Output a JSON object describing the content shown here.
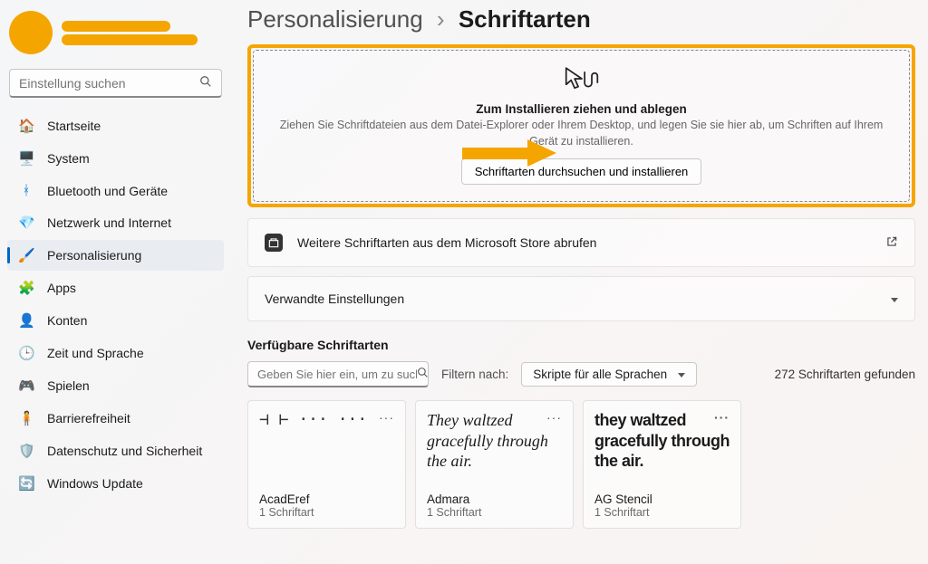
{
  "search": {
    "placeholder": "Einstellung suchen"
  },
  "sidebar": {
    "items": [
      {
        "icon": "🏠",
        "label": "Startseite"
      },
      {
        "icon": "🖥️",
        "label": "System"
      },
      {
        "icon": "ᚼ",
        "label": "Bluetooth und Geräte",
        "iconColor": "#0078d4"
      },
      {
        "icon": "💎",
        "label": "Netzwerk und Internet"
      },
      {
        "icon": "🖌️",
        "label": "Personalisierung"
      },
      {
        "icon": "🧩",
        "label": "Apps"
      },
      {
        "icon": "👤",
        "label": "Konten"
      },
      {
        "icon": "🕒",
        "label": "Zeit und Sprache"
      },
      {
        "icon": "🎮",
        "label": "Spielen"
      },
      {
        "icon": "🧍",
        "label": "Barrierefreiheit",
        "iconColor": "#0078d4"
      },
      {
        "icon": "🛡️",
        "label": "Datenschutz und Sicherheit"
      },
      {
        "icon": "🔄",
        "label": "Windows Update",
        "iconColor": "#0078d4"
      }
    ],
    "selectedIndex": 4
  },
  "breadcrumb": {
    "parent": "Personalisierung",
    "current": "Schriftarten"
  },
  "dragdrop": {
    "title": "Zum Installieren ziehen und ablegen",
    "desc": "Ziehen Sie Schriftdateien aus dem Datei-Explorer oder Ihrem Desktop, und legen Sie sie hier ab, um Schriften auf Ihrem Gerät zu installieren.",
    "button": "Schriftarten durchsuchen und installieren"
  },
  "storeRow": {
    "label": "Weitere Schriftarten aus dem Microsoft Store abrufen"
  },
  "relatedRow": {
    "label": "Verwandte Einstellungen"
  },
  "available": {
    "heading": "Verfügbare Schriftarten",
    "searchPlaceholder": "Geben Sie hier ein, um zu suchen.",
    "filterLabel": "Filtern nach:",
    "filterValue": "Skripte für alle Sprachen",
    "countText": "272 Schriftarten gefunden"
  },
  "fonts": [
    {
      "name": "AcadEref",
      "meta": "1 Schriftart",
      "preview": "⊣ ⊢\n···\n···",
      "styleClass": "preview-acad"
    },
    {
      "name": "Admara",
      "meta": "1 Schriftart",
      "preview": "They waltzed gracefully through the air.",
      "styleClass": "preview-admara"
    },
    {
      "name": "AG Stencil",
      "meta": "1 Schriftart",
      "preview": "they waltzed gracefully through the air.",
      "styleClass": "preview-stencil"
    }
  ]
}
